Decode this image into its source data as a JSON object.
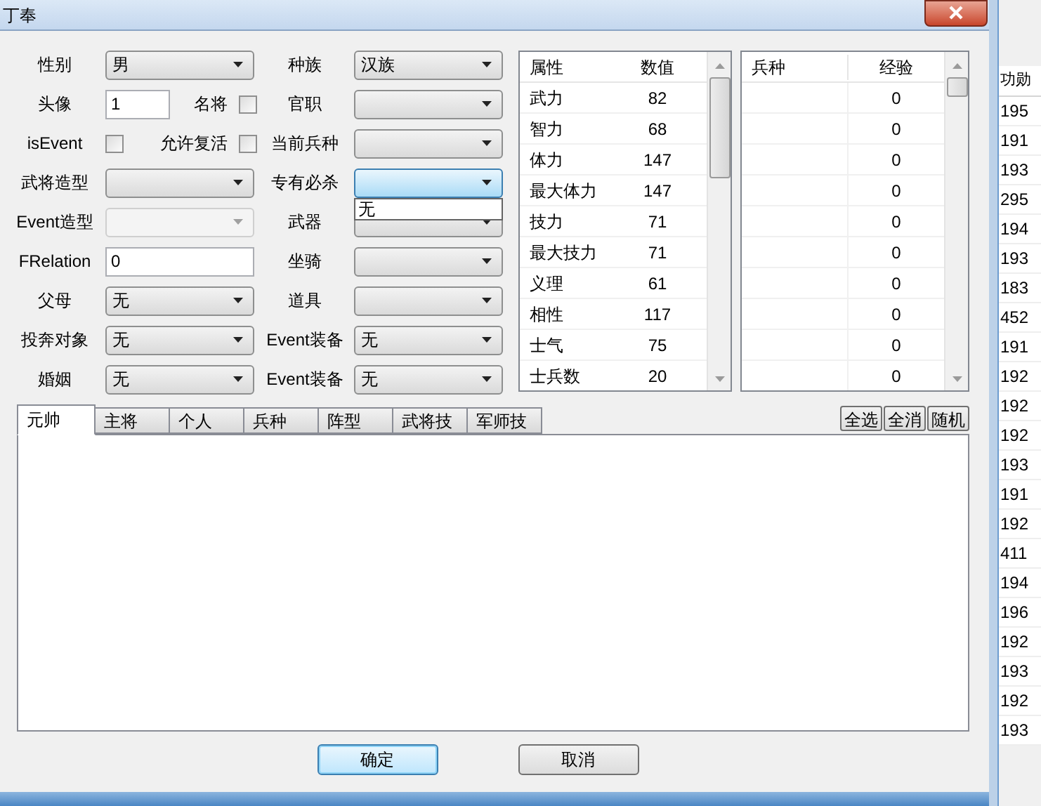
{
  "window": {
    "title": "丁奉"
  },
  "form_rows": [
    {
      "items": [
        {
          "kind": "select",
          "label": "性别",
          "value": "男"
        },
        {
          "kind": "select",
          "label": "种族",
          "value": "汉族"
        }
      ]
    },
    {
      "items": [
        {
          "kind": "text",
          "label": "头像",
          "value": "1"
        },
        {
          "kind": "checkbox",
          "label": "名将",
          "checked": false
        },
        {
          "kind": "select",
          "label": "官职"
        }
      ]
    },
    {
      "items": [
        {
          "kind": "checkbox",
          "label": "isEvent",
          "checked": false
        },
        {
          "kind": "checkbox",
          "label": "允许复活",
          "checked": false
        },
        {
          "kind": "select",
          "label": "当前兵种"
        }
      ]
    },
    {
      "items": [
        {
          "kind": "select",
          "label": "武将造型"
        },
        {
          "kind": "select",
          "label": "专有必杀",
          "focused": true,
          "open": true,
          "options": [
            "无"
          ]
        }
      ]
    },
    {
      "items": [
        {
          "kind": "select",
          "label": "Event造型",
          "disabled": true
        },
        {
          "kind": "select",
          "label": "武器"
        }
      ]
    },
    {
      "items": [
        {
          "kind": "text",
          "label": "FRelation",
          "value": "0"
        },
        {
          "kind": "select",
          "label": "坐骑"
        }
      ]
    },
    {
      "items": [
        {
          "kind": "select",
          "label": "父母",
          "value": "无"
        },
        {
          "kind": "select",
          "label": "道具"
        }
      ]
    },
    {
      "items": [
        {
          "kind": "select",
          "label": "投奔对象",
          "value": "无"
        },
        {
          "kind": "select",
          "label": "Event装备",
          "value": "无"
        }
      ]
    },
    {
      "items": [
        {
          "kind": "select",
          "label": "婚姻",
          "value": "无"
        },
        {
          "kind": "select",
          "label": "Event装备",
          "value": "无"
        }
      ]
    }
  ],
  "attributes": {
    "columns": [
      "属性",
      "数值"
    ],
    "rows": [
      [
        "武力",
        "82"
      ],
      [
        "智力",
        "68"
      ],
      [
        "体力",
        "147"
      ],
      [
        "最大体力",
        "147"
      ],
      [
        "技力",
        "71"
      ],
      [
        "最大技力",
        "71"
      ],
      [
        "义理",
        "61"
      ],
      [
        "相性",
        "117"
      ],
      [
        "士气",
        "75"
      ],
      [
        "士兵数",
        "20"
      ]
    ]
  },
  "troops": {
    "columns": [
      "兵种",
      "经验"
    ],
    "rows": [
      {
        "experience": "0"
      },
      {
        "experience": "0"
      },
      {
        "experience": "0"
      },
      {
        "experience": "0"
      },
      {
        "experience": "0"
      },
      {
        "experience": "0"
      },
      {
        "experience": "0"
      },
      {
        "experience": "0"
      },
      {
        "experience": "0"
      },
      {
        "experience": "0"
      }
    ]
  },
  "tabs": [
    {
      "label": "元帅",
      "selected": true
    },
    {
      "label": "主将",
      "selected": false
    },
    {
      "label": "个人",
      "selected": false
    },
    {
      "label": "兵种",
      "selected": false
    },
    {
      "label": "阵型",
      "selected": false
    },
    {
      "label": "武将技",
      "selected": false
    },
    {
      "label": "军师技",
      "selected": false
    }
  ],
  "tab_actions": [
    "全选",
    "全消",
    "随机"
  ],
  "buttons": [
    {
      "label": "确定",
      "default": true
    },
    {
      "label": "取消",
      "default": false
    }
  ],
  "background_table": {
    "column": "功勋",
    "values": [
      "195",
      "191",
      "193",
      "295",
      "194",
      "193",
      "183",
      "452",
      "191",
      "192",
      "192",
      "192",
      "193",
      "191",
      "192",
      "411",
      "194",
      "196",
      "192",
      "193",
      "192",
      "193"
    ]
  }
}
